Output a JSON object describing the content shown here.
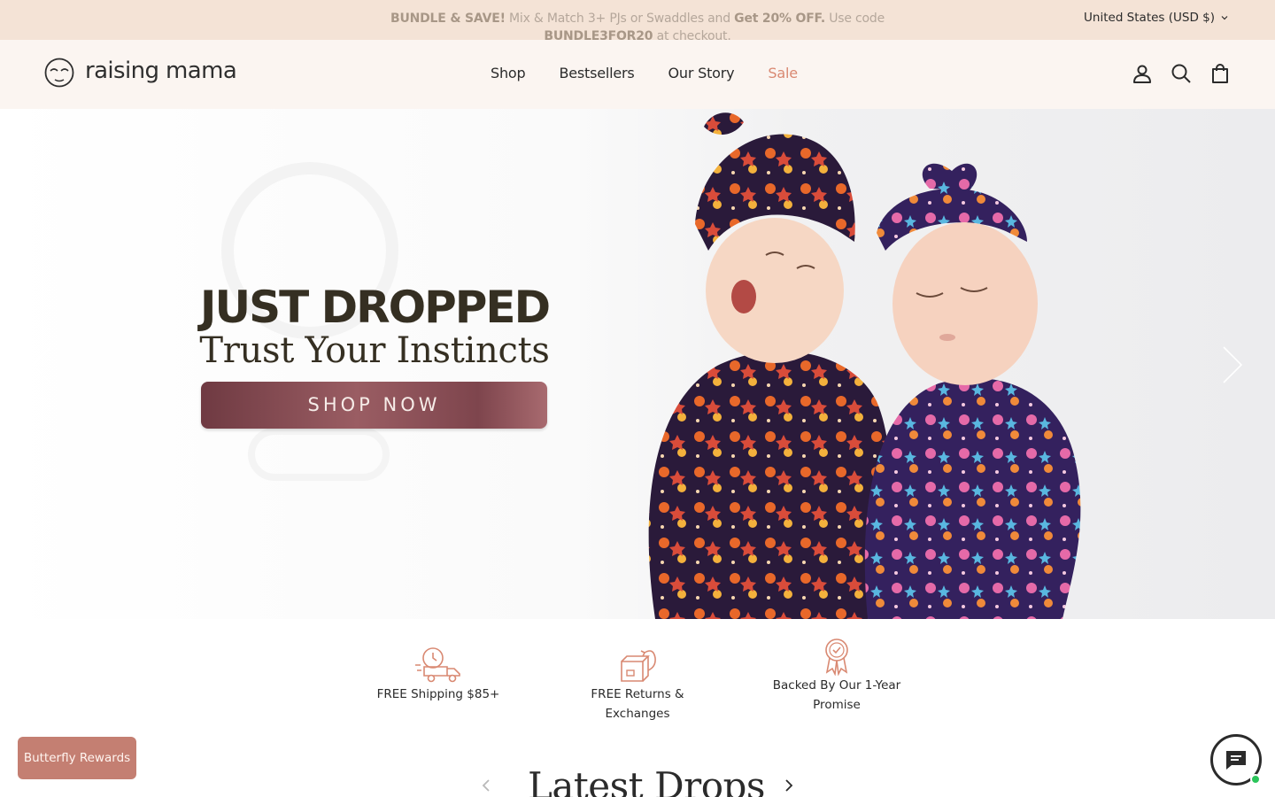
{
  "announcement": {
    "bold1": "BUNDLE & SAVE!",
    "text1": " Mix & Match 3+ PJs or Swaddles and ",
    "bold2": "Get 20% OFF.",
    "text2": " Use code ",
    "code": "BUNDLE3FOR20",
    "text3": " at checkout."
  },
  "currency": {
    "label": "United States (USD $)",
    "icon": "chevron-down-icon"
  },
  "header": {
    "logo_text": "raising mama",
    "nav": [
      {
        "label": "Shop"
      },
      {
        "label": "Bestsellers"
      },
      {
        "label": "Our Story"
      },
      {
        "label": "Sale"
      }
    ],
    "icons": [
      "account-icon",
      "search-icon",
      "cart-icon"
    ]
  },
  "hero": {
    "title": "JUST DROPPED",
    "subtitle": "Trust Your Instincts",
    "cta": "SHOP NOW",
    "prev_icon": "chevron-left-icon",
    "next_icon": "chevron-right-icon"
  },
  "benefits": [
    {
      "icon": "truck-clock-icon",
      "label": "FREE Shipping $85+"
    },
    {
      "icon": "return-box-icon",
      "label": "FREE Returns & Exchanges"
    },
    {
      "icon": "award-ribbon-icon",
      "line1": "Backed By Our 1-Year",
      "line2": "Promise"
    }
  ],
  "rewards": {
    "label": "Butterfly Rewards"
  },
  "latest": {
    "title": "Latest Drops",
    "prev_icon": "chevron-left-icon",
    "next_icon": "chevron-right-icon"
  },
  "chat": {
    "icon": "chat-bubble-icon",
    "status": "online"
  },
  "colors": {
    "announcement_bg": "#f4e3d6",
    "header_bg": "#fbf5f1",
    "accent": "#d98972",
    "cta": "#8a4e55",
    "rewards": "#c47f72"
  }
}
